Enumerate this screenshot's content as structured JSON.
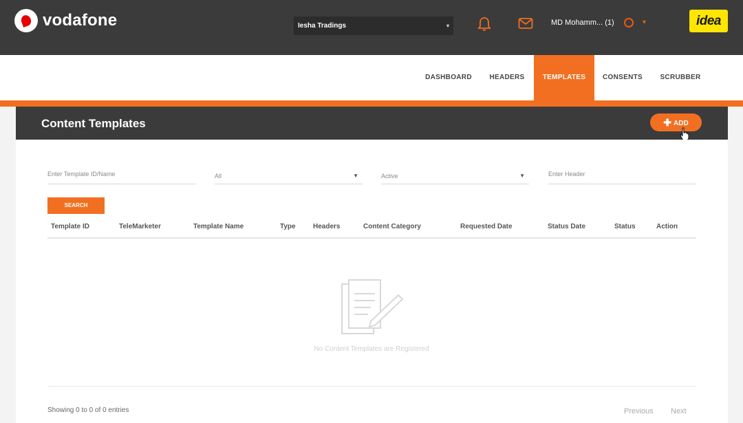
{
  "brand": {
    "name": "vodafone",
    "partner": "idea"
  },
  "header": {
    "org_select": "Iesha Tradings",
    "user_name": "MD Mohamm...  (1)",
    "accent_color": "#f26f21"
  },
  "nav": {
    "items": [
      {
        "label": "DASHBOARD"
      },
      {
        "label": "HEADERS"
      },
      {
        "label": "TEMPLATES"
      },
      {
        "label": "CONSENTS"
      },
      {
        "label": "SCRUBBER"
      }
    ],
    "active": "TEMPLATES"
  },
  "panel": {
    "title": "Content Templates",
    "add_label": "ADD"
  },
  "filters": {
    "template_placeholder": "Enter Template ID/Name",
    "type_value": "All",
    "status_value": "Active",
    "header_placeholder": "Enter Header",
    "search_label": "SEARCH"
  },
  "table": {
    "columns": [
      "Template ID",
      "TeleMarketer",
      "Template Name",
      "Type",
      "Headers",
      "Content Category",
      "Requested Date",
      "Status Date",
      "Status",
      "Action"
    ],
    "empty_message": "No Content Templates are Registered"
  },
  "footer": {
    "entries_text": "Showing 0 to 0 of 0 entries",
    "previous_label": "Previous",
    "next_label": "Next"
  }
}
